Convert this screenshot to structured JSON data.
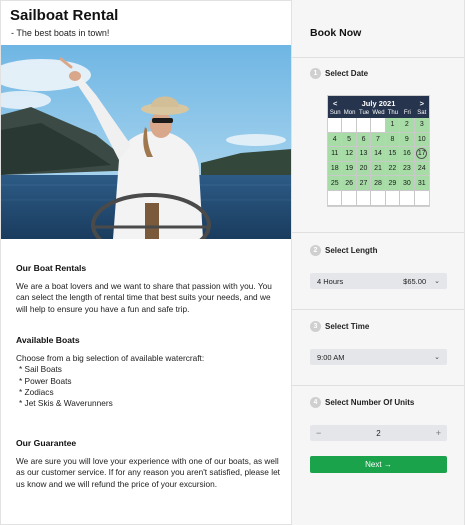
{
  "header": {
    "title": "Sailboat Rental",
    "tagline": "- The best boats in town!"
  },
  "sections": {
    "rentals": {
      "heading": "Our Boat Rentals",
      "body": "We are a boat lovers and we want to share that passion with you. You can select the length of rental time that best suits your needs, and we will help to ensure you have a fun and safe trip."
    },
    "boats": {
      "heading": "Available Boats",
      "intro": "Choose from a big selection of available watercraft:",
      "items": [
        "Sail Boats",
        "Power Boats",
        "Zodiacs",
        "Jet Skis & Waverunners"
      ]
    },
    "guarantee": {
      "heading": "Our Guarantee",
      "body": "We are sure you will love your experience with one of our boats, as well as our customer service. If for any reason you aren't satisfied, please let us know and we will refund the price of your excursion."
    }
  },
  "booking": {
    "title": "Book Now",
    "step1": {
      "num": "1",
      "label": "Select Date"
    },
    "step2": {
      "num": "2",
      "label": "Select Length"
    },
    "step3": {
      "num": "3",
      "label": "Select Time"
    },
    "step4": {
      "num": "4",
      "label": "Select Number Of Units"
    },
    "calendar": {
      "month": "July 2021",
      "prev": "<",
      "next": ">",
      "weekdays": [
        "Sun",
        "Mon",
        "Tue",
        "Wed",
        "Thu",
        "Fri",
        "Sat"
      ],
      "weeks": [
        [
          "",
          "",
          "",
          "",
          "1",
          "2",
          "3"
        ],
        [
          "4",
          "5",
          "6",
          "7",
          "8",
          "9",
          "10"
        ],
        [
          "11",
          "12",
          "13",
          "14",
          "15",
          "16",
          "17"
        ],
        [
          "18",
          "19",
          "20",
          "21",
          "22",
          "23",
          "24"
        ],
        [
          "25",
          "26",
          "27",
          "28",
          "29",
          "30",
          "31"
        ],
        [
          "",
          "",
          "",
          "",
          "",
          "",
          ""
        ]
      ],
      "available_from": 1,
      "today": "17",
      "available_color": "#a7dca7",
      "header_color": "#26344d"
    },
    "length": {
      "value": "4 Hours",
      "price": "$65.00"
    },
    "time": {
      "value": "9:00 AM"
    },
    "units": {
      "minus": "−",
      "value": "2",
      "plus": "+"
    },
    "next_label": "Next →",
    "next_color": "#1aa34a"
  }
}
